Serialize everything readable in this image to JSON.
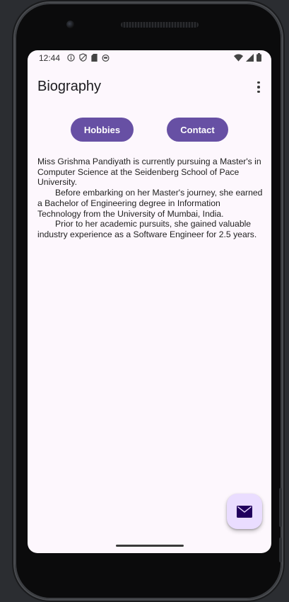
{
  "status_bar": {
    "time": "12:44"
  },
  "app_bar": {
    "title": "Biography"
  },
  "buttons": {
    "hobbies": "Hobbies",
    "contact": "Contact"
  },
  "bio": {
    "paragraphs": [
      "Miss Grishma Pandiyath is currently pursuing a Master's in Computer Science at the Seidenberg School of Pace University.",
      "Before embarking on her Master's journey, she earned a Bachelor of Engineering degree in Information Technology from the University of Mumbai, India.",
      "Prior to her academic pursuits, she gained valuable industry experience as a Software Engineer for 2.5 years."
    ]
  },
  "fab": {
    "icon": "mail-icon"
  },
  "colors": {
    "primary": "#6750a4",
    "background": "#fdf7fd",
    "fab_container": "#eaddff",
    "fab_icon": "#21005d"
  }
}
